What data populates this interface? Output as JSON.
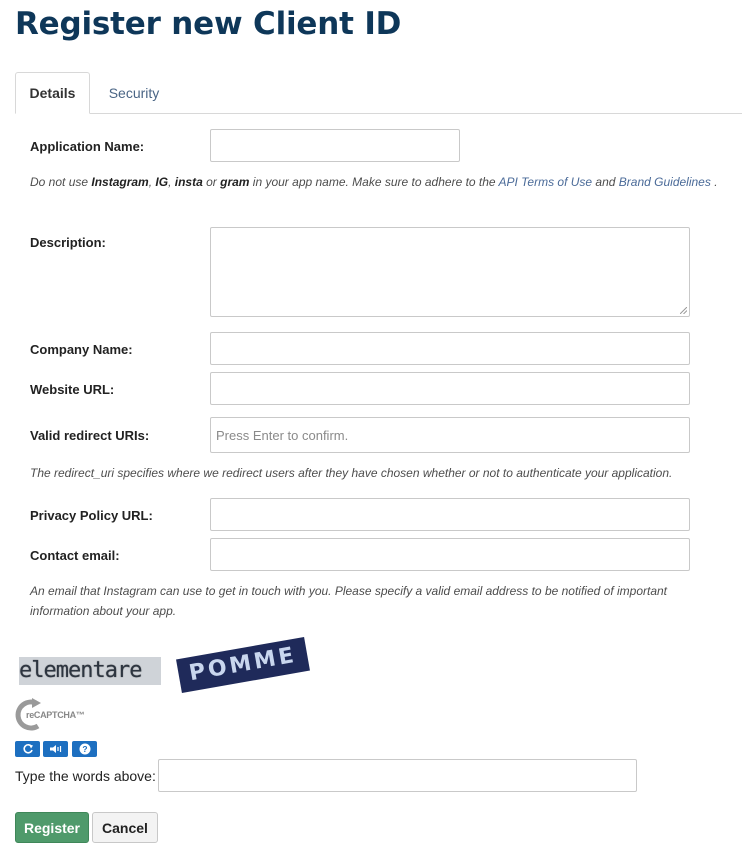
{
  "page": {
    "title": "Register new Client ID"
  },
  "tabs": [
    {
      "label": "Details",
      "active": true
    },
    {
      "label": "Security",
      "active": false
    }
  ],
  "form": {
    "application_name": {
      "label": "Application Name:",
      "value": ""
    },
    "app_name_help": {
      "t1": "Do not use ",
      "b1": "Instagram",
      "t2": ", ",
      "b2": "IG",
      "t3": ", ",
      "b3": "insta",
      "t4": " or ",
      "b4": "gram",
      "t5": " in your app name. Make sure to adhere to the ",
      "link1": "API Terms of Use",
      "t6": " and ",
      "link2": "Brand Guidelines",
      "t7": " ."
    },
    "description": {
      "label": "Description:",
      "value": ""
    },
    "company_name": {
      "label": "Company Name:",
      "value": ""
    },
    "website_url": {
      "label": "Website URL:",
      "value": ""
    },
    "redirect_uris": {
      "label": "Valid redirect URIs:",
      "placeholder": "Press Enter to confirm.",
      "value": ""
    },
    "redirect_help": "The redirect_uri specifies where we redirect users after they have chosen whether or not to authenticate your application.",
    "privacy_policy_url": {
      "label": "Privacy Policy URL:",
      "value": ""
    },
    "contact_email": {
      "label": "Contact email:",
      "value": ""
    },
    "email_help": "An email that Instagram can use to get in touch with you. Please specify a valid email address to be notified of important information about your app."
  },
  "captcha": {
    "word1": "elementare",
    "word2": "POMME",
    "logo_text": "reCAPTCHA™",
    "buttons": [
      "refresh-icon",
      "audio-icon",
      "help-icon"
    ],
    "input_label": "Type the words above:",
    "input_value": ""
  },
  "actions": {
    "register_label": "Register",
    "cancel_label": "Cancel"
  },
  "colors": {
    "title": "#0e3759",
    "register_bg": "#4f9a6b",
    "link": "#4a6a98",
    "recaptcha_button": "#1d6fc0"
  }
}
